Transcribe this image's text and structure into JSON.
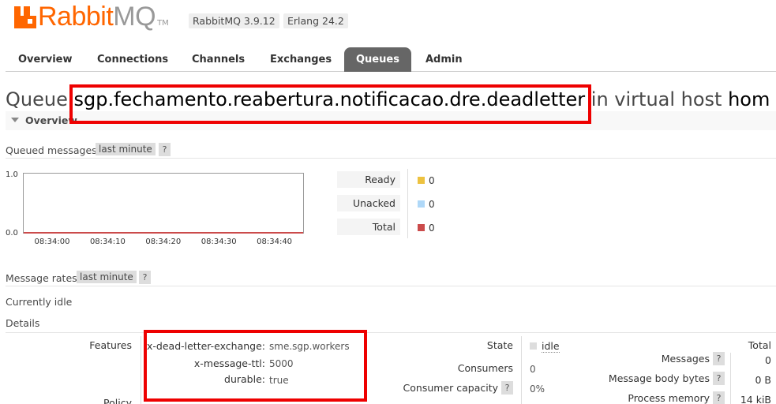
{
  "header": {
    "logo_rabbit": "Rabbit",
    "logo_mq": "MQ",
    "logo_tm": "TM",
    "rabbitmq_version": "RabbitMQ 3.9.12",
    "erlang_version": "Erlang 24.2"
  },
  "tabs": [
    {
      "label": "Overview"
    },
    {
      "label": "Connections"
    },
    {
      "label": "Channels"
    },
    {
      "label": "Exchanges"
    },
    {
      "label": "Queues"
    },
    {
      "label": "Admin"
    }
  ],
  "page": {
    "title_prefix": "Queue ",
    "queue_name": "sgp.fechamento.reabertura.notificacao.dre.deadletter",
    "title_mid": " in virtual host ",
    "vhost": "hom",
    "overview_label": "Overview"
  },
  "queued_messages": {
    "label": "Queued messages",
    "range": "last minute",
    "help": "?",
    "legend": [
      {
        "name": "Ready",
        "value": "0",
        "color": "#edc240"
      },
      {
        "name": "Unacked",
        "value": "0",
        "color": "#afd8f8"
      },
      {
        "name": "Total",
        "value": "0",
        "color": "#cb4b4b"
      }
    ]
  },
  "chart_data": {
    "type": "line",
    "x": [
      "08:34:00",
      "08:34:10",
      "08:34:20",
      "08:34:30",
      "08:34:40"
    ],
    "ylim": [
      0.0,
      1.0
    ],
    "yticks": [
      "1.0",
      "0.0"
    ],
    "series": [
      {
        "name": "Ready",
        "values": [
          0,
          0,
          0,
          0,
          0
        ],
        "color": "#edc240"
      },
      {
        "name": "Unacked",
        "values": [
          0,
          0,
          0,
          0,
          0
        ],
        "color": "#afd8f8"
      },
      {
        "name": "Total",
        "values": [
          0,
          0,
          0,
          0,
          0
        ],
        "color": "#cb4b4b"
      }
    ]
  },
  "message_rates": {
    "label": "Message rates",
    "range": "last minute",
    "help": "?",
    "status": "Currently idle"
  },
  "details": {
    "label": "Details",
    "features_label": "Features",
    "features": [
      {
        "key": "x-dead-letter-exchange:",
        "value": "sme.sgp.workers"
      },
      {
        "key": "x-message-ttl:",
        "value": "5000"
      },
      {
        "key": "durable:",
        "value": "true"
      }
    ],
    "policy_label": "Policy",
    "state_label": "State",
    "state_value": "idle",
    "consumers_label": "Consumers",
    "consumers_value": "0",
    "consumer_capacity_label": "Consumer capacity",
    "consumer_capacity_value": "0%",
    "help": "?",
    "total_header": "Total",
    "stats": [
      {
        "label": "Messages",
        "value": "0"
      },
      {
        "label": "Message body bytes",
        "value": "0 B"
      },
      {
        "label": "Process memory",
        "value": "14 kiB"
      }
    ]
  }
}
